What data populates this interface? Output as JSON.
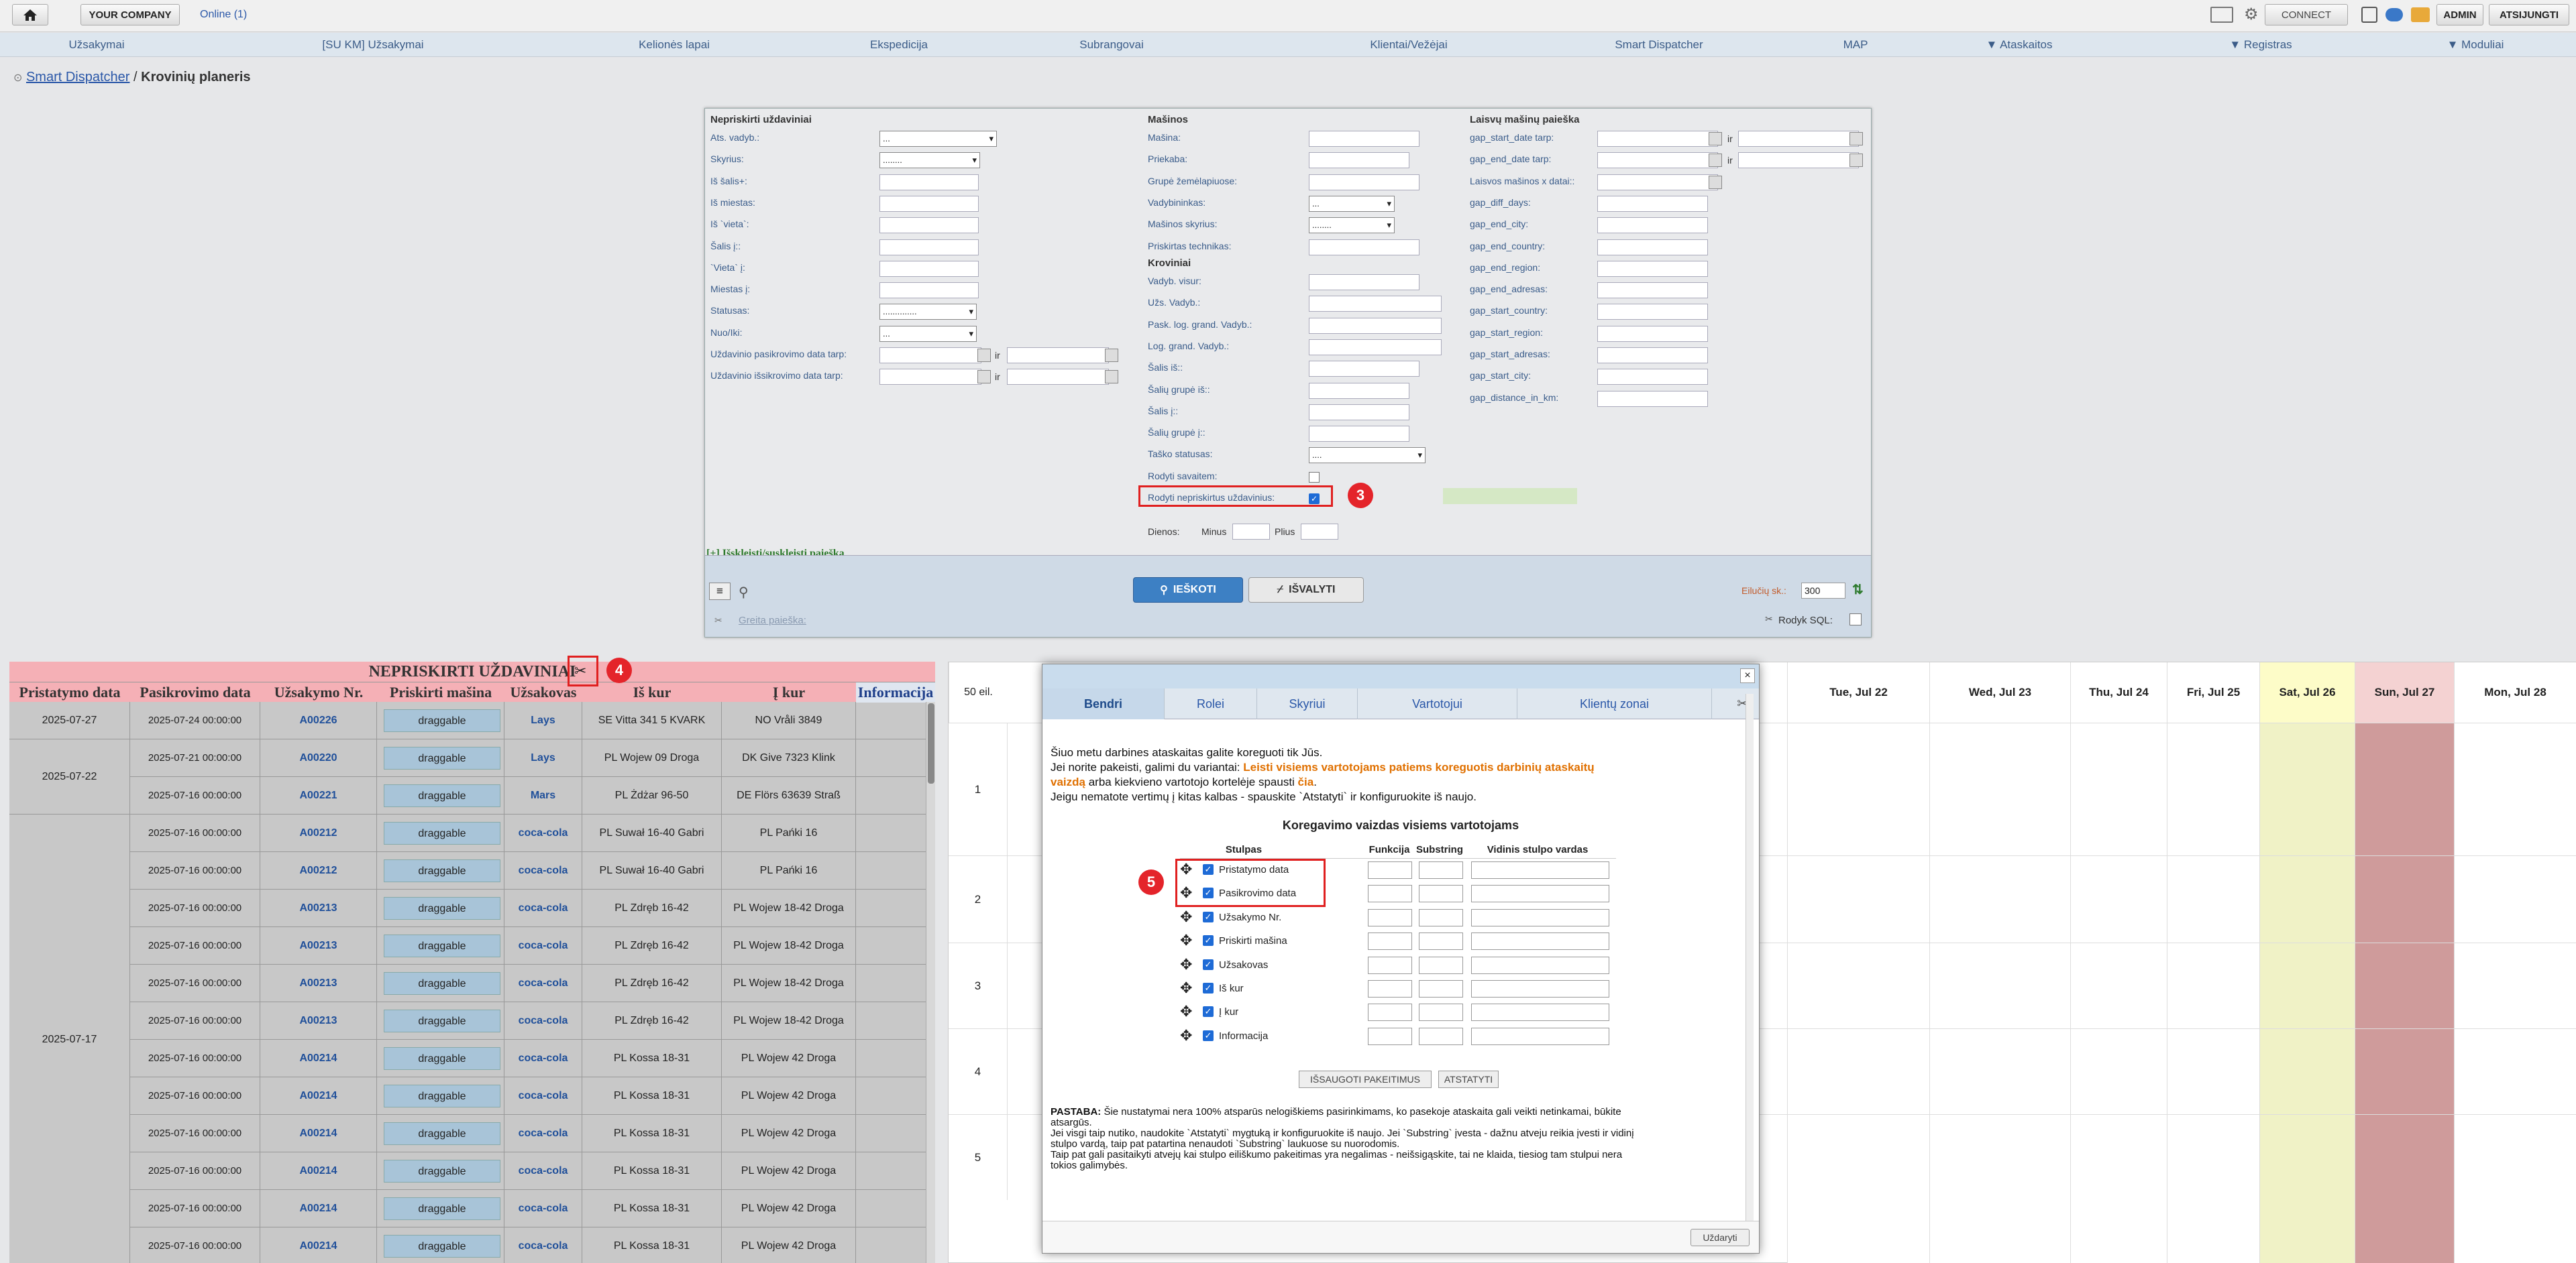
{
  "topbar": {
    "company": "YOUR COMPANY",
    "online": "Online (1)",
    "connect": "CONNECT",
    "admin": "ADMIN",
    "logout": "ATSIJUNGTI"
  },
  "nav": [
    "Užsakymai",
    "[SU KM] Užsakymai",
    "Kelionės lapai",
    "Ekspedicija",
    "Subrangovai",
    "Klientai/Vežėjai",
    "Smart Dispatcher",
    "MAP",
    "▼ Ataskaitos",
    "▼ Registras",
    "▼ Moduliai"
  ],
  "breadcrumb": {
    "root": "Smart Dispatcher",
    "sep": "/",
    "current": "Krovinių planeris"
  },
  "panel": {
    "col1_title": "Nepriskirti uždaviniai",
    "col1": [
      "Ats. vadyb.:",
      "Skyrius:",
      "Iš šalis+:",
      "Iš miestas:",
      "Iš `vieta`:",
      "Šalis į::",
      "`Vieta` į:",
      "Miestas į:",
      "Statusas:",
      "Nuo/Iki:",
      "Uždavinio pasikrovimo data tarp:",
      "Uždavinio išsikrovimo data tarp:"
    ],
    "col1_selects": {
      "ats": "...",
      "skyrius": "........",
      "statusas": "..............",
      "nuo": "..."
    },
    "ir": "ir",
    "col2_title": "Mašinos",
    "col2": [
      "Mašina:",
      "Priekaba:",
      "Grupė žemėlapiuose:",
      "Vadybininkas:",
      "Mašinos skyrius:",
      "Priskirtas technikas:"
    ],
    "col2_selects": {
      "vadyb": "...",
      "skyrius": "........"
    },
    "col2b_title": "Kroviniai",
    "col2b": [
      "Vadyb. visur:",
      "Užs. Vadyb.:",
      "Pask. log. grand. Vadyb.:",
      "Log. grand. Vadyb.:",
      "Šalis iš::",
      "Šalių grupė iš::",
      "Šalis į::",
      "Šalių grupė į::",
      "Taško statusas:",
      "Rodyti savaitem:",
      "Rodyti nepriskirtus uždavinius:"
    ],
    "tasko_sel": "....",
    "dienos": "Dienos:",
    "minus": "Minus",
    "plius": "Plius",
    "col3_title": "Laisvų mašinų paieška",
    "col3": [
      "gap_start_date tarp:",
      "gap_end_date tarp:",
      "Laisvos mašinos x datai::",
      "gap_diff_days:",
      "gap_end_city:",
      "gap_end_country:",
      "gap_end_region:",
      "gap_end_adresas:",
      "gap_start_country:",
      "gap_start_region:",
      "gap_start_adresas:",
      "gap_start_city:",
      "gap_distance_in_km:"
    ],
    "expand": "[+] Išskleisti/suskleisti paiešką",
    "search": "IEŠKOTI",
    "clear": "IŠVALYTI",
    "rows_label": "Eilučių sk.:",
    "rows_value": "300",
    "quick": "Greita paieška:",
    "sql": "Rodyk SQL:"
  },
  "left_table": {
    "title": "NEPRISKIRTI UŽDAVINIAI",
    "columns": [
      "Pristatymo data",
      "Pasikrovimo data",
      "Užsakymo Nr.",
      "Priskirti mašina",
      "Užsakovas",
      "Iš kur",
      "Į kur",
      "Informacija"
    ],
    "groups": [
      {
        "date": "2025-07-27",
        "rows": 1
      },
      {
        "date": "2025-07-22",
        "rows": 2
      },
      {
        "date": "2025-07-17",
        "rows": 12
      }
    ],
    "rows": [
      [
        "2025-07-24 00:00:00",
        "A00226",
        "draggable",
        "Lays",
        "SE Vitta 341 5 KVARK",
        "NO Vråli 3849"
      ],
      [
        "2025-07-21 00:00:00",
        "A00220",
        "draggable",
        "Lays",
        "PL Wojew 09 Droga",
        "DK Give 7323 Klink"
      ],
      [
        "2025-07-16 00:00:00",
        "A00221",
        "draggable",
        "Mars",
        "PL Żdżar 96-50",
        "DE Flörs 63639 Straß"
      ],
      [
        "2025-07-16 00:00:00",
        "A00212",
        "draggable",
        "coca-cola",
        "PL Suwał 16-40 Gabri",
        "PL Pańki 16"
      ],
      [
        "2025-07-16 00:00:00",
        "A00212",
        "draggable",
        "coca-cola",
        "PL Suwał 16-40 Gabri",
        "PL Pańki 16"
      ],
      [
        "2025-07-16 00:00:00",
        "A00213",
        "draggable",
        "coca-cola",
        "PL Zdręb 16-42",
        "PL Wojew 18-42 Droga"
      ],
      [
        "2025-07-16 00:00:00",
        "A00213",
        "draggable",
        "coca-cola",
        "PL Zdręb 16-42",
        "PL Wojew 18-42 Droga"
      ],
      [
        "2025-07-16 00:00:00",
        "A00213",
        "draggable",
        "coca-cola",
        "PL Zdręb 16-42",
        "PL Wojew 18-42 Droga"
      ],
      [
        "2025-07-16 00:00:00",
        "A00213",
        "draggable",
        "coca-cola",
        "PL Zdręb 16-42",
        "PL Wojew 18-42 Droga"
      ],
      [
        "2025-07-16 00:00:00",
        "A00214",
        "draggable",
        "coca-cola",
        "PL Kossa 18-31",
        "PL Wojew 42 Droga"
      ],
      [
        "2025-07-16 00:00:00",
        "A00214",
        "draggable",
        "coca-cola",
        "PL Kossa 18-31",
        "PL Wojew 42 Droga"
      ],
      [
        "2025-07-16 00:00:00",
        "A00214",
        "draggable",
        "coca-cola",
        "PL Kossa 18-31",
        "PL Wojew 42 Droga"
      ],
      [
        "2025-07-16 00:00:00",
        "A00214",
        "draggable",
        "coca-cola",
        "PL Kossa 18-31",
        "PL Wojew 42 Droga"
      ],
      [
        "2025-07-16 00:00:00",
        "A00214",
        "draggable",
        "coca-cola",
        "PL Kossa 18-31",
        "PL Wojew 42 Droga"
      ],
      [
        "2025-07-16 00:00:00",
        "A00214",
        "draggable",
        "coca-cola",
        "PL Kossa 18-31",
        "PL Wojew 42 Droga"
      ]
    ]
  },
  "calendar": {
    "rows_label": "50 eil.",
    "days": [
      "Tue, Jul 22",
      "Wed, Jul 23",
      "Thu, Jul 24",
      "Fri, Jul 25",
      "Sat, Jul 26",
      "Sun, Jul 27",
      "Mon, Jul 28"
    ],
    "row_numbers": [
      "1",
      "2",
      "3",
      "4",
      "5"
    ]
  },
  "modal": {
    "tabs": [
      "Bendri",
      "Rolei",
      "Skyriui",
      "Vartotojui",
      "Klientų zonai"
    ],
    "line1": "Šiuo metu darbines ataskaitas galite koreguoti tik Jūs.",
    "line2a": "Jei norite pakeisti, galimi du variantai: ",
    "line2b": "Leisti visiems vartotojams patiems koreguotis darbinių ataskaitų",
    "line3a": "vaizdą",
    "line3b": " arba kiekvieno vartotojo kortelėje spausti ",
    "line3c": "čia",
    "line4": "Jeigu nematote vertimų į kitas kalbas - spauskite `Atstatyti` ir konfiguruokite iš naujo.",
    "subtitle": "Koregavimo vaizdas visiems vartotojams",
    "col_headers": [
      "Stulpas",
      "Funkcija",
      "Substring",
      "Vidinis stulpo vardas"
    ],
    "columns": [
      "Pristatymo data",
      "Pasikrovimo data",
      "Užsakymo Nr.",
      "Priskirti mašina",
      "Užsakovas",
      "Iš kur",
      "Į kur",
      "Informacija"
    ],
    "save": "IŠSAUGOTI PAKEITIMUS",
    "reset": "ATSTATYTI",
    "note_label": "PASTABA:",
    "note1": " Šie nustatymai nera 100% atsparūs nelogiškiems pasirinkimams, ko pasekoje ataskaita gali veikti netinkamai, būkite",
    "note2": "atsargūs.",
    "note3": "Jei visgi taip nutiko, naudokite `Atstatyti` mygtuką ir konfiguruokite iš naujo. Jei `Substring` įvesta - dažnu atveju reikia įvesti ir vidinį",
    "note4": "stulpo vardą, taip pat patartina nenaudoti `Substring` laukuose su nuorodomis.",
    "note5": "Taip pat gali pasitaikyti atvejų kai stulpo eiliškumo pakeitimas yra negalimas - neišsigąskite, tai ne klaida, tiesiog tam stulpui nera",
    "note6": "tokios galimybės.",
    "close": "Uždaryti"
  },
  "badges": [
    "3",
    "4",
    "5"
  ],
  "colors": {
    "accent": "#2a6ab0",
    "alert": "#e4242a",
    "unassigned_header": "#f5b0b6",
    "saturday": "#fdfcc8",
    "sunday": "#cf9b9b"
  }
}
